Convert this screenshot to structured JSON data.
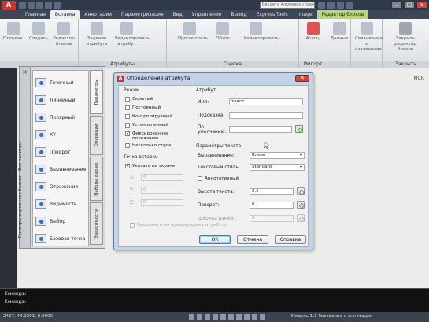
{
  "titlebar": {
    "app_button": "A",
    "search_placeholder": "Введите ключевое слово/фразу"
  },
  "tabs": [
    "Главная",
    "Вставка",
    "Аннотации",
    "Параметризация",
    "Вид",
    "Управление",
    "Вывод",
    "Express Tools",
    "Image",
    "Редактор блоков"
  ],
  "ribbon": {
    "panels": [
      {
        "title": "",
        "buttons": [
          "Отредак.",
          "Создать",
          "Редактор блоков"
        ]
      },
      {
        "title": "Атрибуты",
        "buttons": [
          "Задание атрибута",
          "Редактировать атрибут"
        ]
      },
      {
        "title": "Сцепка",
        "buttons": [
          "Просмотреть",
          "Обзор",
          "Редактировать"
        ]
      },
      {
        "title": "Импорт",
        "buttons": [
          "Ассоц."
        ]
      },
      {
        "title": "",
        "buttons": [
          "Данные"
        ]
      },
      {
        "title": "",
        "buttons": [
          "Связывание и извлечение"
        ]
      },
      {
        "title": "Закрыть",
        "buttons": [
          "Закрыть редактор блоков"
        ]
      }
    ]
  },
  "palette": {
    "vertical_title": "Палитры вариантов блоков - Все палитры",
    "items": [
      "Точечный",
      "Линейный",
      "Полярный",
      "XY",
      "Поворот",
      "Отражение",
      "Видимость",
      "Выбор",
      "Базовая точка",
      "Выравнивание"
    ],
    "tabs": [
      "Параметры",
      "Операции",
      "Наборы парам.",
      "Зависимости"
    ]
  },
  "dialog": {
    "title": "Определение атрибута",
    "close": "✕",
    "mode": {
      "label": "Режим",
      "options": [
        {
          "label": "Скрытый",
          "checked": false
        },
        {
          "label": "Постоянный",
          "checked": false
        },
        {
          "label": "Контролируемый",
          "checked": false
        },
        {
          "label": "Установленный",
          "checked": false
        },
        {
          "label": "Фиксированное положение",
          "checked": true
        },
        {
          "label": "Несколько строк",
          "checked": false
        }
      ]
    },
    "insertion": {
      "label": "Точка вставки",
      "specify_on_screen": "Указать на экране",
      "checked": true,
      "coords": [
        {
          "axis": "X:",
          "value": "0"
        },
        {
          "axis": "Y:",
          "value": "0"
        },
        {
          "axis": "Z:",
          "value": "0"
        }
      ]
    },
    "attribute": {
      "label": "Атрибут",
      "tag_label": "Имя:",
      "tag_value": "текст",
      "prompt_label": "Подсказка:",
      "prompt_value": "",
      "default_label": "По умолчанию:",
      "default_value": ""
    },
    "text_settings": {
      "label": "Параметры текста",
      "justification_label": "Выравнивание:",
      "justification_value": "Влево",
      "style_label": "Текстовый стиль:",
      "style_value": "Standard",
      "annotative_label": "Аннотативный",
      "height_label": "Высота текста:",
      "height_value": "2.5",
      "rotation_label": "Поворот:",
      "rotation_value": "0",
      "boundary_label": "Ширина рамки:",
      "boundary_value": "0"
    },
    "align_below": "Выровнять по предыдущему атрибуту",
    "buttons": {
      "ok": "ОК",
      "cancel": "Отмена",
      "help": "Справка"
    }
  },
  "workspace": {
    "wcs_label": "МСК"
  },
  "command": {
    "lines": [
      "Команда:",
      "Команда:"
    ]
  },
  "statusbar": {
    "coords": "2467, 44.2201, 0.0000",
    "right_text": "Модель  1:1  Рисование и аннотации"
  }
}
